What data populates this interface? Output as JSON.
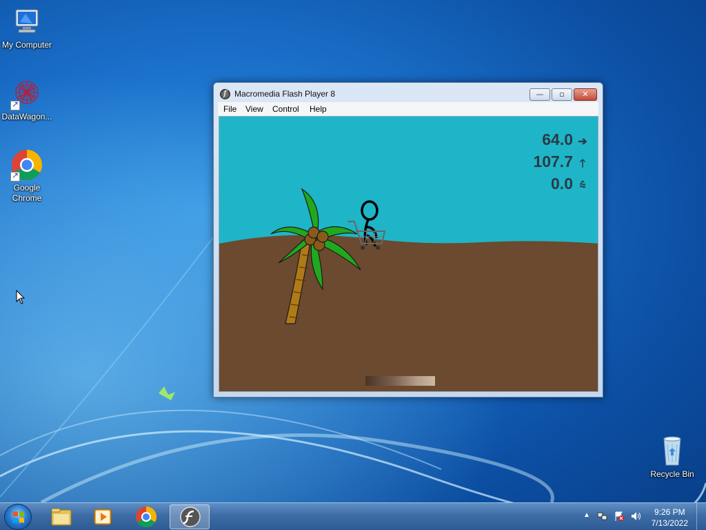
{
  "desktop": {
    "icons": [
      {
        "label": "My Computer",
        "icon": "computer-icon"
      },
      {
        "label": "DataWagon...",
        "icon": "datawagon-icon"
      },
      {
        "label": "Google Chrome",
        "icon": "chrome-icon"
      },
      {
        "label": "Recycle Bin",
        "icon": "recycle-bin-icon"
      }
    ]
  },
  "window": {
    "title": "Macromedia Flash Player 8",
    "buttons": {
      "minimize": "—",
      "maximize": "▫",
      "close": "✕"
    },
    "menu": [
      "File",
      "View",
      "Control",
      "Help"
    ]
  },
  "game": {
    "hud": [
      {
        "value": "64.0",
        "icon": "arrow-right-icon",
        "glyph": "➔"
      },
      {
        "value": "107.7",
        "icon": "arrow-up-icon",
        "glyph": "🡑"
      },
      {
        "value": "0.0",
        "icon": "bounce-icon",
        "glyph": "⩯"
      }
    ],
    "power_fill": 1.0,
    "colors": {
      "sky": "#1fb5c8",
      "ground": "#6b4a2f",
      "palm_leaf": "#22a81e",
      "trunk": "#b07a18"
    }
  },
  "taskbar": {
    "items": [
      "start-button",
      "explorer-icon",
      "media-player-icon",
      "chrome-icon",
      "flash-player-icon"
    ],
    "clock": {
      "time": "9:26 PM",
      "date": "7/13/2022"
    },
    "tray_icons": [
      "show-hidden-icon",
      "network-icon",
      "action-center-icon",
      "volume-icon"
    ]
  }
}
